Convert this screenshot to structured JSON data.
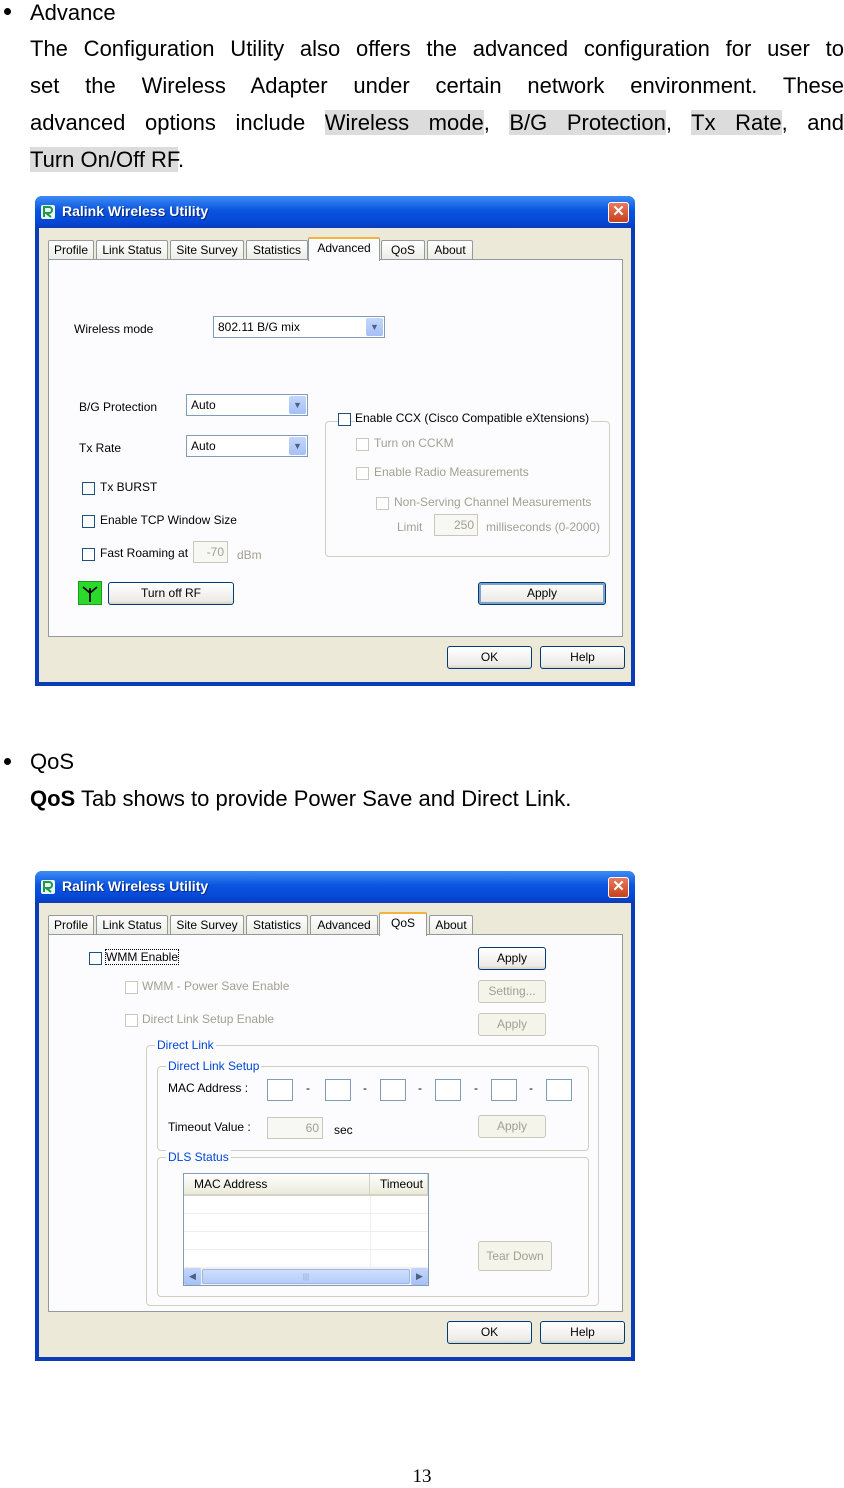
{
  "advance_section": {
    "heading": "Advance",
    "para_line1": "The Configuration Utility also offers the advanced configuration for user to",
    "para_line2": "set the Wireless Adapter under certain network environment. These",
    "para_line3_a": "advanced options include ",
    "hl_wireless_mode": "Wireless mode",
    "comma1": ", ",
    "hl_bg_protection": "B/G Protection",
    "comma2": ", ",
    "hl_tx_rate": "Tx Rate",
    "and_text": ", and",
    "hl_turn_rf": "Turn On/Off RF",
    "period": "."
  },
  "qos_section": {
    "heading": "QoS",
    "bold_lead": "QoS",
    "para_rest": " Tab shows to provide Power Save and Direct Link."
  },
  "window": {
    "title": "Ralink Wireless Utility",
    "close_symbol": "✕",
    "tabs": [
      "Profile",
      "Link Status",
      "Site Survey",
      "Statistics",
      "Advanced",
      "QoS",
      "About"
    ],
    "ok_label": "OK",
    "help_label": "Help"
  },
  "advanced_tab": {
    "wireless_mode_label": "Wireless mode",
    "wireless_mode_value": "802.11 B/G mix",
    "bg_protection_label": "B/G Protection",
    "bg_protection_value": "Auto",
    "tx_rate_label": "Tx Rate",
    "tx_rate_value": "Auto",
    "tx_burst_label": "Tx BURST",
    "tcp_window_label": "Enable TCP Window Size",
    "fast_roaming_label": "Fast Roaming at",
    "fast_roaming_value": "-70",
    "dbm_label": "dBm",
    "turn_off_rf_label": "Turn off RF",
    "apply_label": "Apply",
    "ccx_label": "Enable CCX (Cisco Compatible eXtensions)",
    "cckm_label": "Turn on CCKM",
    "radio_measure_label": "Enable Radio Measurements",
    "non_serving_label": "Non-Serving Channel Measurements",
    "limit_label": "Limit",
    "limit_value": "250",
    "ms_label": "milliseconds (0-2000)"
  },
  "qos_tab": {
    "wmm_enable_label": "WMM Enable",
    "wmm_power_label": "WMM - Power Save Enable",
    "direct_link_setup_enable_label": "Direct Link Setup Enable",
    "apply_label": "Apply",
    "setting_label": "Setting...",
    "apply2_label": "Apply",
    "direct_link_group": "Direct Link",
    "direct_link_setup_group": "Direct Link Setup",
    "mac_address_label": "MAC Address :",
    "dash": "-",
    "timeout_label": "Timeout Value :",
    "timeout_value": "60",
    "sec_label": "sec",
    "apply3_label": "Apply",
    "dls_status_group": "DLS Status",
    "col_mac": "MAC Address",
    "col_timeout": "Timeout",
    "tear_down_label": "Tear Down",
    "scroll_left": "◀",
    "scroll_right": "▶",
    "scroll_grip": "|||"
  },
  "page_number": "13"
}
